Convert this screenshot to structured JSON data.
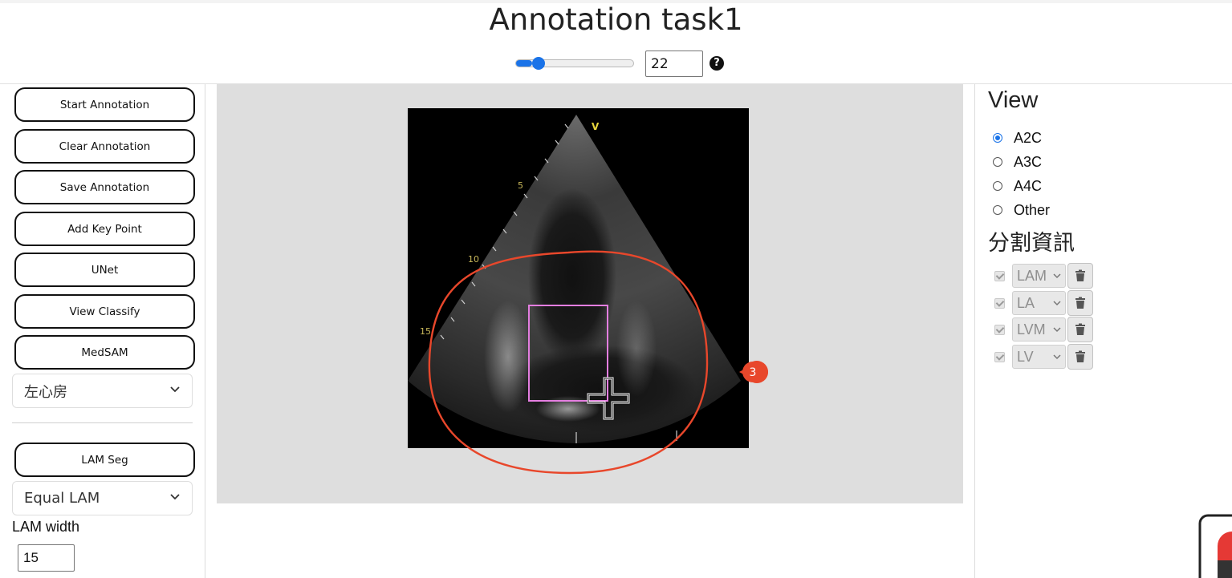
{
  "header": {
    "title": "Annotation task1"
  },
  "slider": {
    "value": "22",
    "fraction": 0.14,
    "help_icon": "question-circle-icon"
  },
  "toolbar": {
    "buttons": [
      "Start Annotation",
      "Clear Annotation",
      "Save Annotation",
      "Add Key Point",
      "UNet",
      "View Classify",
      "MedSAM"
    ],
    "region_select": "左心房",
    "lam_seg_button": "LAM Seg",
    "lam_mode_select": "Equal LAM",
    "lam_width_label": "LAM width",
    "lam_width_value": "15"
  },
  "image": {
    "depth_labels": [
      "V",
      "5",
      "10",
      "15"
    ],
    "box_color": "#e47ee0",
    "annotation_circle_color": "#e8472b"
  },
  "step_badge": {
    "label": "3",
    "color": "#e8472b"
  },
  "view_panel": {
    "title": "View",
    "options": [
      "A2C",
      "A3C",
      "A4C",
      "Other"
    ],
    "selected": "A2C"
  },
  "segmentation_panel": {
    "title": "分割資訊",
    "items": [
      "LAM",
      "LA",
      "LVM",
      "LV"
    ],
    "delete_icon": "trash-icon"
  },
  "colors": {
    "accent": "#1a73e8"
  }
}
